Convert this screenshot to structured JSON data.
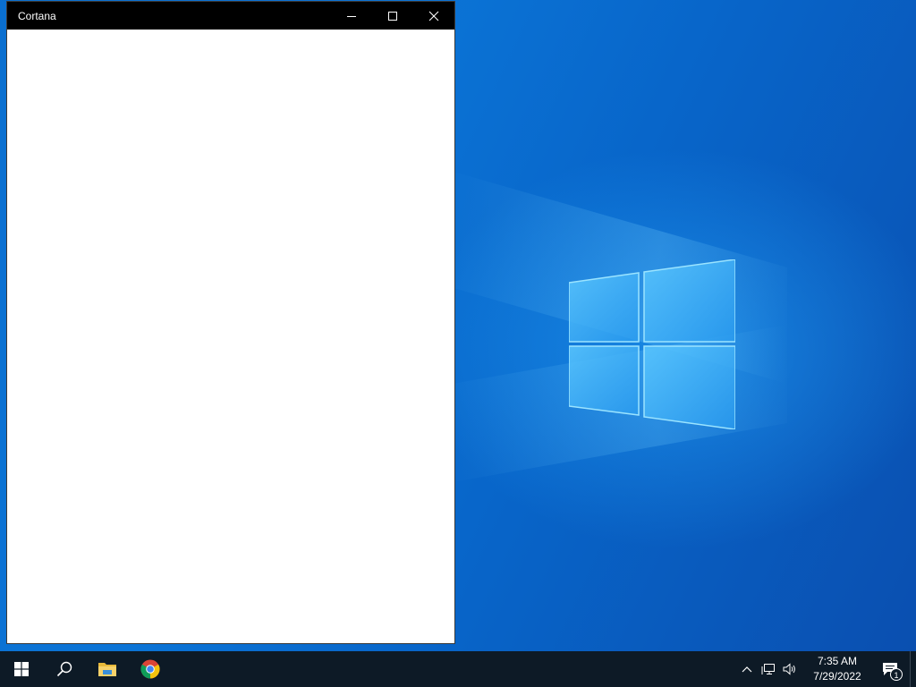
{
  "window": {
    "title": "Cortana"
  },
  "taskbar": {
    "apps": [
      {
        "icon": "windows-start-icon"
      },
      {
        "icon": "search-icon"
      },
      {
        "icon": "file-explorer-icon"
      },
      {
        "icon": "chrome-icon"
      }
    ],
    "tray": {
      "clock_time": "7:35 AM",
      "clock_date": "7/29/2022",
      "notification_count": "1"
    }
  },
  "colors": {
    "desktop_blue": "#0a6fd0",
    "taskbar": "#0d1a26",
    "titlebar": "#000000"
  }
}
